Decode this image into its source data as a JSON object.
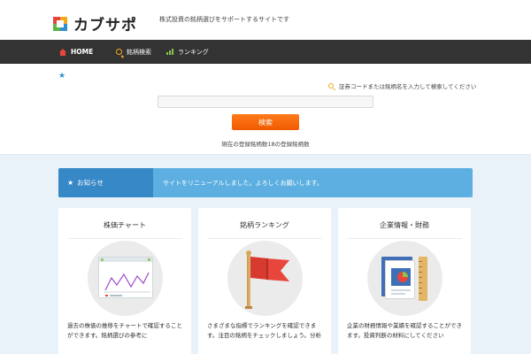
{
  "header": {
    "logo_text": "カブサポ",
    "tagline": "株式投資の銘柄選びをサポートするサイトです"
  },
  "nav": {
    "items": [
      {
        "label": "HOME",
        "icon": "home-icon"
      },
      {
        "label": "銘柄検索",
        "icon": "search-icon"
      },
      {
        "label": "ランキング",
        "icon": "bar-chart-icon"
      }
    ]
  },
  "search": {
    "hint": "証券コードまたは銘柄名を入力して検索してください",
    "placeholder": "",
    "value": "",
    "button_label": "検索",
    "count_text": "現在の登録銘柄数18の登録銘柄数"
  },
  "banner": {
    "label": "お知らせ",
    "text": "サイトをリニューアルしました。よろしくお願いします。"
  },
  "cards": [
    {
      "title": "株価チャート",
      "icon": "line-chart-icon",
      "description": "過去の株価の推移をチャートで確認することができます。銘柄選びの参考に"
    },
    {
      "title": "銘柄ランキング",
      "icon": "flag-icon",
      "description": "さまざまな指標でランキングを確認できます。注目の銘柄をチェックしましょう。分析"
    },
    {
      "title": "企業情報・財務",
      "icon": "document-icon",
      "description": "企業の財務情報や業績を確認することができます。投資判断の材料にしてください"
    }
  ],
  "colors": {
    "nav_bg": "#333333",
    "accent_orange": "#f05a00",
    "banner_blue": "#5cafe0",
    "banner_dark": "#3688c6",
    "main_bg": "#e9f2f9"
  }
}
